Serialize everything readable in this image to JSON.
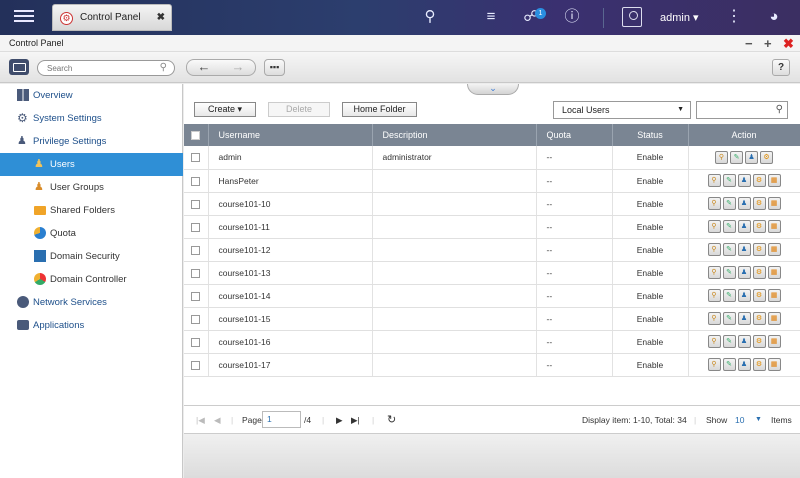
{
  "topbar": {
    "tab_label": "Control Panel",
    "tab_close": "✖",
    "badge_count": "1",
    "user_name": "admin ▾",
    "menu_dots": "⋮"
  },
  "window": {
    "title": "Control Panel",
    "minimize": "−",
    "maximize": "+",
    "close": "✖"
  },
  "toolbar": {
    "search_placeholder": "Search",
    "back": "←",
    "forward": "→",
    "grid": "▪▪▪",
    "help": "?"
  },
  "sidebar": {
    "items": [
      {
        "label": "Overview",
        "icon": "overview-icon"
      },
      {
        "label": "System Settings",
        "icon": "gear-icon"
      },
      {
        "label": "Privilege Settings",
        "icon": "user-icon"
      },
      {
        "label": "Users",
        "icon": "user-icon",
        "active": true
      },
      {
        "label": "User Groups",
        "icon": "user-group-icon"
      },
      {
        "label": "Shared Folders",
        "icon": "folder-icon"
      },
      {
        "label": "Quota",
        "icon": "quota-icon"
      },
      {
        "label": "Domain Security",
        "icon": "domain-icon"
      },
      {
        "label": "Domain Controller",
        "icon": "domain-controller-icon"
      },
      {
        "label": "Network Services",
        "icon": "globe-icon"
      },
      {
        "label": "Applications",
        "icon": "applications-icon"
      }
    ]
  },
  "main": {
    "create_label": "Create ▾",
    "delete_label": "Delete",
    "home_folder_label": "Home Folder",
    "user_type": "Local Users",
    "columns": [
      "Username",
      "Description",
      "Quota",
      "Status",
      "Action"
    ],
    "rows": [
      {
        "username": "admin",
        "description": "administrator",
        "quota": "--",
        "status": "Enable"
      },
      {
        "username": "HansPeter",
        "description": "",
        "quota": "--",
        "status": "Enable"
      },
      {
        "username": "course101-10",
        "description": "",
        "quota": "--",
        "status": "Enable"
      },
      {
        "username": "course101-11",
        "description": "",
        "quota": "--",
        "status": "Enable"
      },
      {
        "username": "course101-12",
        "description": "",
        "quota": "--",
        "status": "Enable"
      },
      {
        "username": "course101-13",
        "description": "",
        "quota": "--",
        "status": "Enable"
      },
      {
        "username": "course101-14",
        "description": "",
        "quota": "--",
        "status": "Enable"
      },
      {
        "username": "course101-15",
        "description": "",
        "quota": "--",
        "status": "Enable"
      },
      {
        "username": "course101-16",
        "description": "",
        "quota": "--",
        "status": "Enable"
      },
      {
        "username": "course101-17",
        "description": "",
        "quota": "--",
        "status": "Enable"
      }
    ]
  },
  "pager": {
    "page_label": "Page",
    "page_value": "1",
    "page_total": "/4",
    "display_info": "Display item: 1-10, Total: 34",
    "show_label": "Show",
    "show_value": "10",
    "items_label": "Items"
  }
}
